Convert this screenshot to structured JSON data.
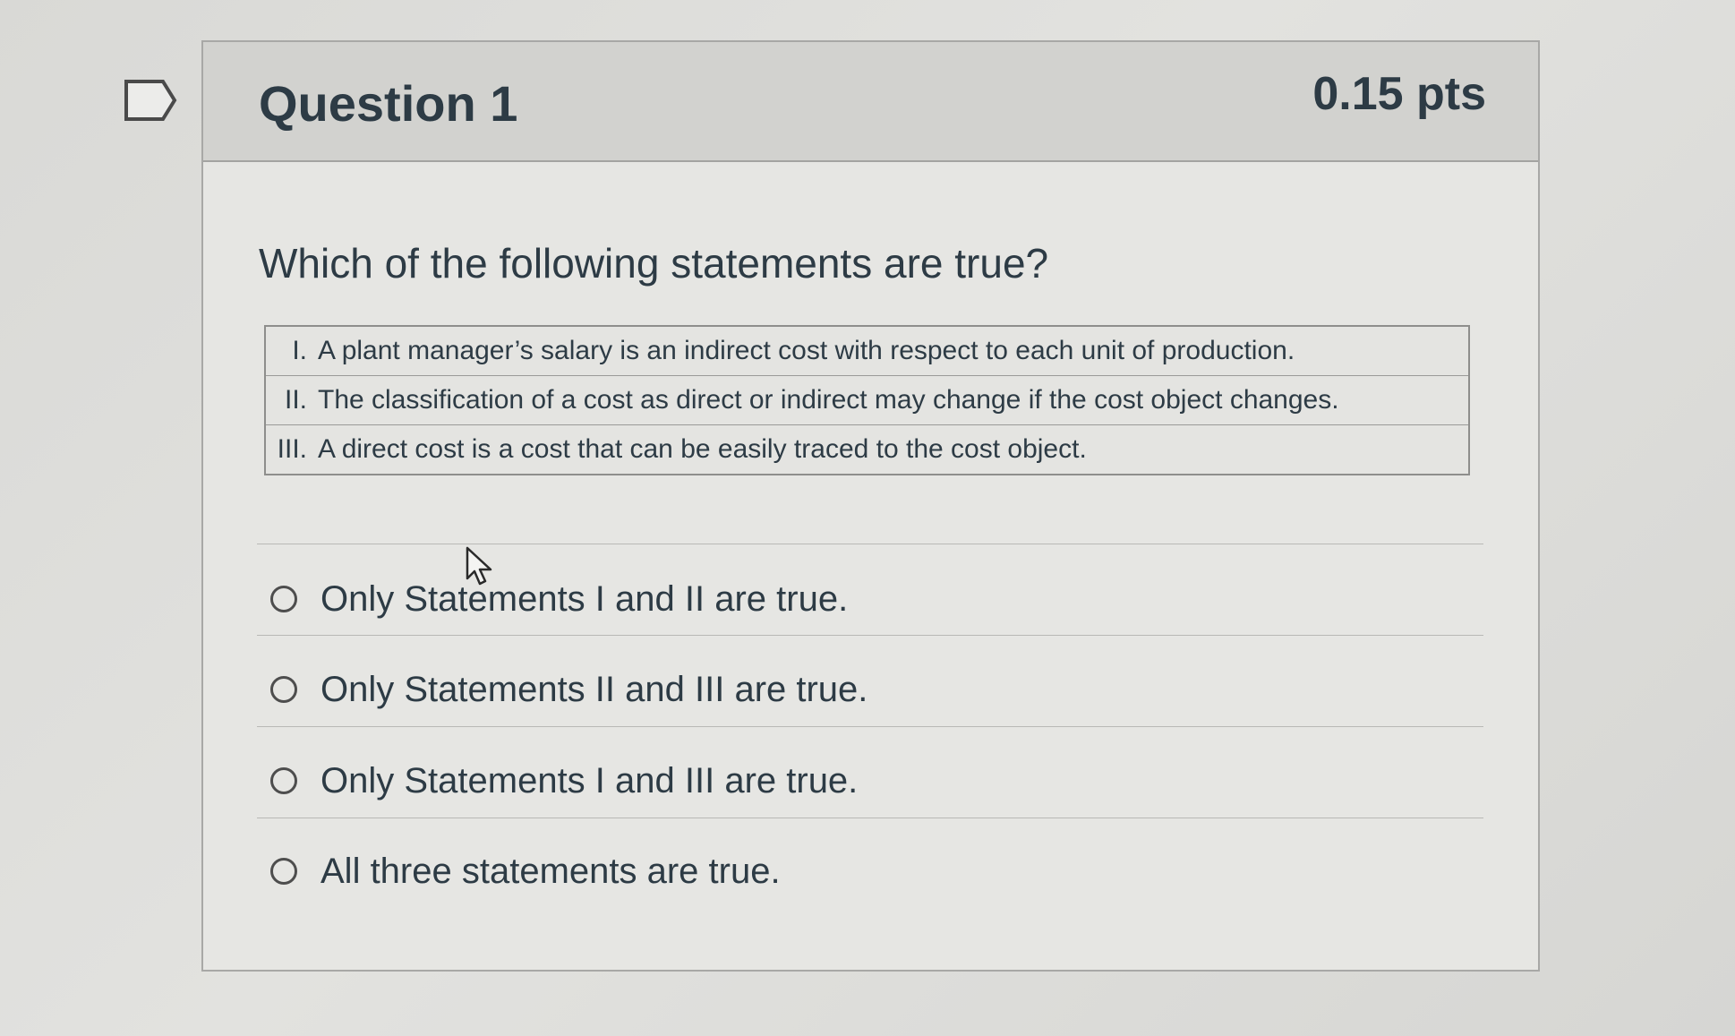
{
  "question": {
    "title": "Question 1",
    "points": "0.15 pts",
    "prompt": "Which of the following statements are true?"
  },
  "statements": [
    {
      "numeral": "I.",
      "text": "A plant manager’s salary is an indirect cost with respect to each unit of production."
    },
    {
      "numeral": "II.",
      "text": "The classification of a cost as direct or indirect may change if the cost object changes."
    },
    {
      "numeral": "III.",
      "text": "A direct cost is a cost that can be easily traced to the cost object."
    }
  ],
  "answers": [
    {
      "label": "Only Statements I and II are true.",
      "selected": false
    },
    {
      "label": "Only Statements II and III are true.",
      "selected": false
    },
    {
      "label": "Only Statements I and III are true.",
      "selected": false
    },
    {
      "label": "All three statements are true.",
      "selected": false
    }
  ],
  "icons": {
    "flag": "flag-question-icon",
    "cursor": "mouse-pointer-icon"
  }
}
